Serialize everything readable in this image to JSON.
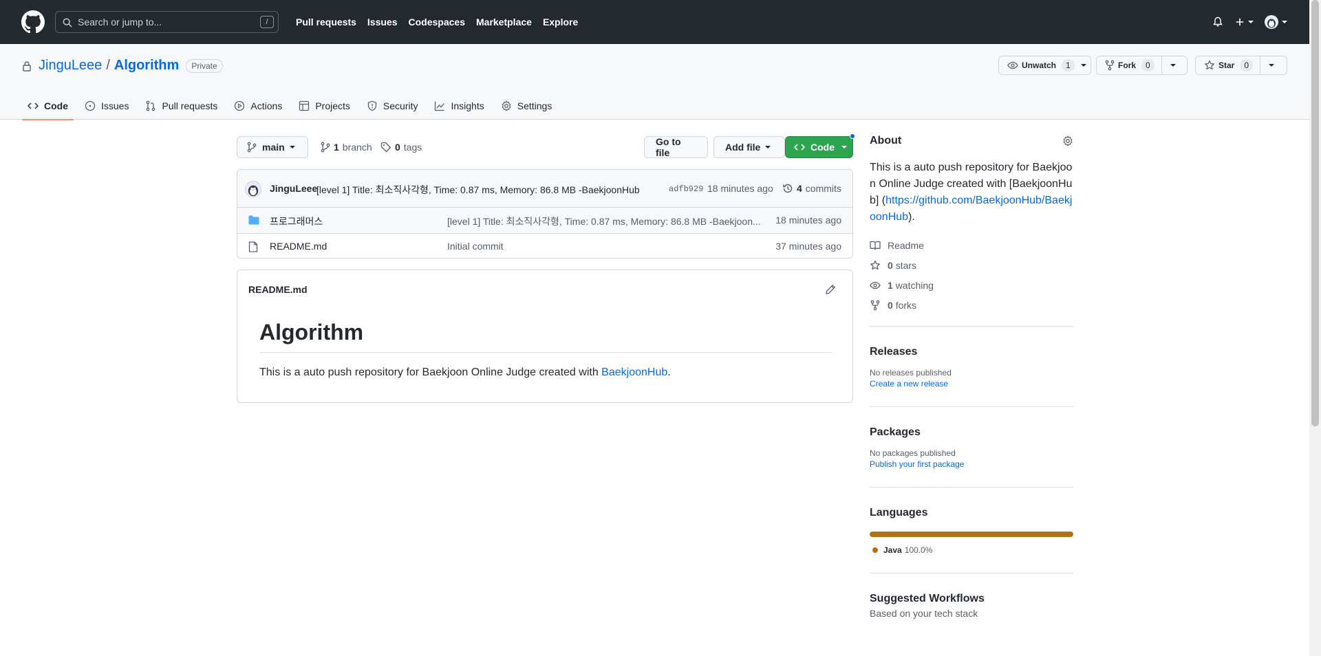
{
  "header": {
    "search_placeholder": "Search or jump to...",
    "search_key": "/",
    "nav": [
      "Pull requests",
      "Issues",
      "Codespaces",
      "Marketplace",
      "Explore"
    ]
  },
  "repo": {
    "owner": "JinguLeee",
    "separator": "/",
    "name": "Algorithm",
    "visibility": "Private",
    "actions": {
      "watch_label": "Unwatch",
      "watch_count": "1",
      "fork_label": "Fork",
      "fork_count": "0",
      "star_label": "Star",
      "star_count": "0"
    },
    "tabs": [
      "Code",
      "Issues",
      "Pull requests",
      "Actions",
      "Projects",
      "Security",
      "Insights",
      "Settings"
    ]
  },
  "toolbar": {
    "branch": "main",
    "branch_count": "1",
    "branch_label": "branch",
    "tag_count": "0",
    "tag_label": "tags",
    "go_to_file": "Go to file",
    "add_file": "Add file",
    "code": "Code"
  },
  "latest_commit": {
    "author": "JinguLeee",
    "message": "[level 1] Title: 최소직사각형, Time: 0.87 ms, Memory: 86.8 MB -BaekjoonHub",
    "sha": "adfb929",
    "ago": "18 minutes ago",
    "commit_count": "4",
    "commit_label": "commits"
  },
  "files": [
    {
      "type": "folder",
      "name": "프로그래머스",
      "message": "[level 1] Title: 최소직사각형, Time: 0.87 ms, Memory: 86.8 MB -Baekjoon...",
      "age": "18 minutes ago"
    },
    {
      "type": "file",
      "name": "README.md",
      "message": "Initial commit",
      "age": "37 minutes ago"
    }
  ],
  "readme": {
    "filename": "README.md",
    "heading": "Algorithm",
    "text_before": "This is a auto push repository for Baekjoon Online Judge created with ",
    "link": "BaekjoonHub",
    "text_after": "."
  },
  "about": {
    "title": "About",
    "description_text": "This is a auto push repository for Baekjoon Online Judge created with [BaekjoonHub] (",
    "description_link": "https://github.com/BaekjoonHub/BaekjoonHub",
    "description_end": ").",
    "readme": "Readme",
    "stars_count": "0",
    "stars_label": "stars",
    "watching_count": "1",
    "watching_label": "watching",
    "forks_count": "0",
    "forks_label": "forks"
  },
  "releases": {
    "title": "Releases",
    "empty": "No releases published",
    "link": "Create a new release"
  },
  "packages": {
    "title": "Packages",
    "empty": "No packages published",
    "link": "Publish your first package"
  },
  "languages": {
    "title": "Languages",
    "items": [
      {
        "name": "Java",
        "percent": "100.0%",
        "color": "#b07219"
      }
    ]
  },
  "workflows": {
    "title": "Suggested Workflows",
    "subtitle": "Based on your tech stack"
  }
}
